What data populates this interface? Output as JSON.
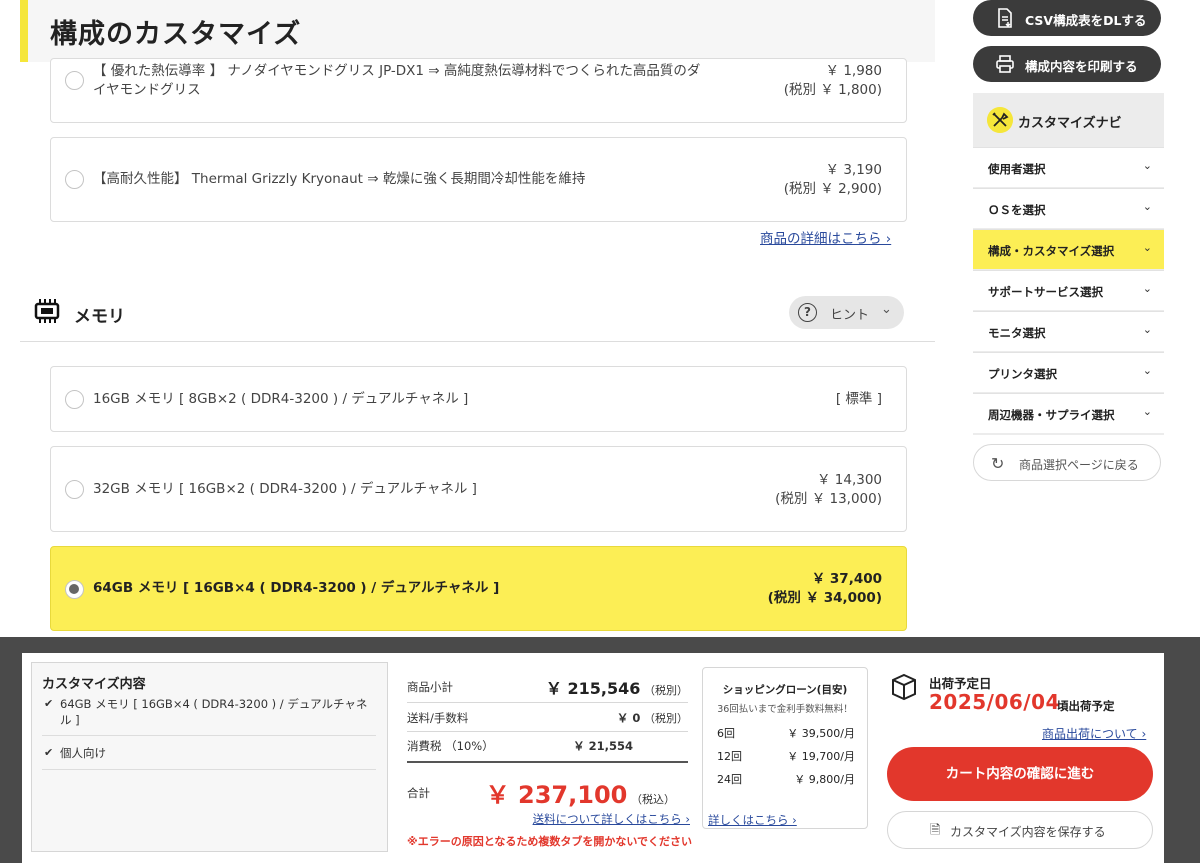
{
  "page": {
    "title": "構成のカスタマイズ"
  },
  "paste": {
    "options": [
      {
        "label_line1": "【 優れた熱伝導率 】 ナノダイヤモンドグリス JP-DX1 ⇒ 高純度熱伝導材料でつくられた高品質のダ",
        "label_line2": "イヤモンドグリス",
        "price": "￥ 1,980",
        "tax": "(税別 ￥ 1,800)"
      },
      {
        "label_line1": "【高耐久性能】 Thermal Grizzly Kryonaut ⇒ 乾燥に強く長期間冷却性能を維持",
        "price": "￥ 3,190",
        "tax": "(税別 ￥ 2,900)"
      }
    ],
    "detail_link": "商品の詳細はこちら ›"
  },
  "memory": {
    "title": "メモリ",
    "hint": "ヒント",
    "options": [
      {
        "label": "16GB メモリ [ 8GB×2 ( DDR4-3200 ) / デュアルチャネル ]",
        "price": "[ 標準 ]",
        "tax": "",
        "selected": false
      },
      {
        "label": "32GB メモリ [ 16GB×2 ( DDR4-3200 ) / デュアルチャネル ]",
        "price": "￥ 14,300",
        "tax": "(税別 ￥ 13,000)",
        "selected": false
      },
      {
        "label": "64GB メモリ [ 16GB×4 ( DDR4-3200 ) / デュアルチャネル ]",
        "price": "￥ 37,400",
        "tax": "(税別 ￥ 34,000)",
        "selected": true
      }
    ]
  },
  "sidebar": {
    "csv_button": "CSV構成表をDLする",
    "print_button": "構成内容を印刷する",
    "navi_title": "カスタマイズナビ",
    "navi_items": [
      {
        "label": "使用者選択",
        "active": false
      },
      {
        "label": "ＯＳを選択",
        "active": false
      },
      {
        "label": "構成・カスタマイズ選択",
        "active": true
      },
      {
        "label": "サポートサービス選択",
        "active": false
      },
      {
        "label": "モニタ選択",
        "active": false
      },
      {
        "label": "プリンタ選択",
        "active": false
      },
      {
        "label": "周辺機器・サプライ選択",
        "active": false
      }
    ],
    "back_button": "商品選択ページに戻る"
  },
  "summary": {
    "customize": {
      "title": "カスタマイズ内容",
      "items": [
        "64GB メモリ [ 16GB×4 ( DDR4-3200 ) / デュアルチャネル ]",
        "個人向け"
      ]
    },
    "prices": {
      "subtotal_label": "商品小計",
      "subtotal_value": "￥ 215,546",
      "subtotal_note": "（税別）",
      "shipping_label": "送料/手数料",
      "shipping_value": "￥ 0",
      "shipping_note": "（税別）",
      "tax_label": "消費税 （10%）",
      "tax_value": "￥ 21,554",
      "total_label": "合計",
      "total_value": "￥ 237,100",
      "total_note": "（税込）",
      "shipping_link": "送料について詳しくはこちら ›",
      "warning": "※エラーの原因となるため複数タブを開かないでください"
    },
    "loan": {
      "title": "ショッピングローン(目安)",
      "subtitle": "36回払いまで金利手数料無料！",
      "rows": [
        {
          "k": "6回",
          "v": "￥ 39,500/月"
        },
        {
          "k": "12回",
          "v": "￥ 19,700/月"
        },
        {
          "k": "24回",
          "v": "￥ 9,800/月"
        }
      ],
      "more": "詳しくはこちら ›"
    },
    "shipping": {
      "label": "出荷予定日",
      "date": "2025/06/04",
      "suffix": "頃出荷予定",
      "about": "商品出荷について ›",
      "cart_button": "カート内容の確認に進む",
      "save_button": "カスタマイズ内容を保存する"
    }
  },
  "colors": {
    "accent_yellow": "#fcee55",
    "red": "#e2372c",
    "link": "#2a4a9c",
    "dark_button": "#3b3b3b"
  }
}
